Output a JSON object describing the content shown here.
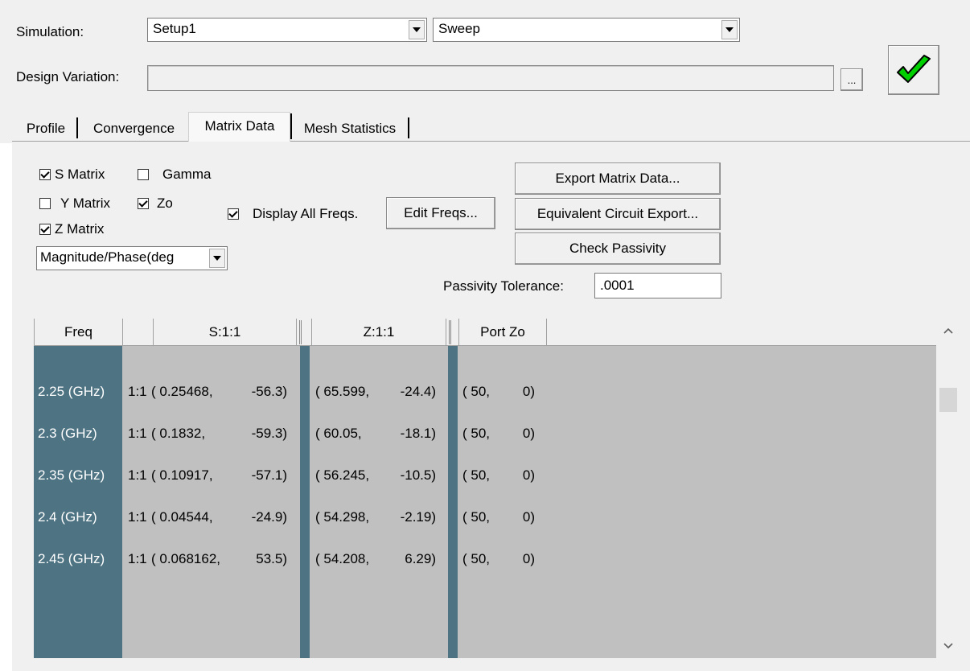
{
  "simulation": {
    "label": "Simulation:",
    "setup_value": "Setup1",
    "sweep_value": "Sweep"
  },
  "design_variation": {
    "label": "Design Variation:",
    "value": "",
    "browse_label": "..."
  },
  "tabs": [
    {
      "label": "Profile",
      "active": false
    },
    {
      "label": "Convergence",
      "active": false
    },
    {
      "label": "Matrix Data",
      "active": true
    },
    {
      "label": "Mesh Statistics",
      "active": false
    }
  ],
  "options": {
    "s_matrix": {
      "label": "S Matrix",
      "checked": true
    },
    "gamma": {
      "label": "Gamma",
      "checked": false
    },
    "y_matrix": {
      "label": "Y Matrix",
      "checked": false
    },
    "zo": {
      "label": "Zo",
      "checked": true
    },
    "z_matrix": {
      "label": "Z Matrix",
      "checked": true
    },
    "display_all": {
      "label": "Display All Freqs.",
      "checked": true
    },
    "format_value": "Magnitude/Phase(deg"
  },
  "buttons": {
    "edit_freqs": "Edit Freqs...",
    "export_matrix": "Export Matrix Data...",
    "equiv_circuit": "Equivalent Circuit Export...",
    "check_passivity": "Check Passivity"
  },
  "passivity": {
    "label": "Passivity Tolerance:",
    "value": ".0001"
  },
  "table": {
    "headers": {
      "freq": "Freq",
      "s": "S:1:1",
      "z": "Z:1:1",
      "port": "Port Zo"
    },
    "rows": [
      {
        "freq": "2.25 (GHz)",
        "s_port": "1:1",
        "s_mag": "( 0.25468,",
        "s_phase": "-56.3)",
        "z_mag": "( 65.599,",
        "z_phase": "-24.4)",
        "zo_mag": "( 50,",
        "zo_phase": "0)"
      },
      {
        "freq": "2.3 (GHz)",
        "s_port": "1:1",
        "s_mag": "( 0.1832,",
        "s_phase": "-59.3)",
        "z_mag": "( 60.05,",
        "z_phase": "-18.1)",
        "zo_mag": "( 50,",
        "zo_phase": "0)"
      },
      {
        "freq": "2.35 (GHz)",
        "s_port": "1:1",
        "s_mag": "( 0.10917,",
        "s_phase": "-57.1)",
        "z_mag": "( 56.245,",
        "z_phase": "-10.5)",
        "zo_mag": "( 50,",
        "zo_phase": "0)"
      },
      {
        "freq": "2.4 (GHz)",
        "s_port": "1:1",
        "s_mag": "( 0.04544,",
        "s_phase": "-24.9)",
        "z_mag": "( 54.298,",
        "z_phase": "-2.19)",
        "zo_mag": "( 50,",
        "zo_phase": "0)"
      },
      {
        "freq": "2.45 (GHz)",
        "s_port": "1:1",
        "s_mag": "( 0.068162,",
        "s_phase": "53.5)",
        "z_mag": "( 54.208,",
        "z_phase": "6.29)",
        "zo_mag": "( 50,",
        "zo_phase": "0)"
      }
    ]
  },
  "colors": {
    "freq_column": "#4e7383",
    "grid_background": "#c0c0c0",
    "accent_check": "#00cc00"
  }
}
